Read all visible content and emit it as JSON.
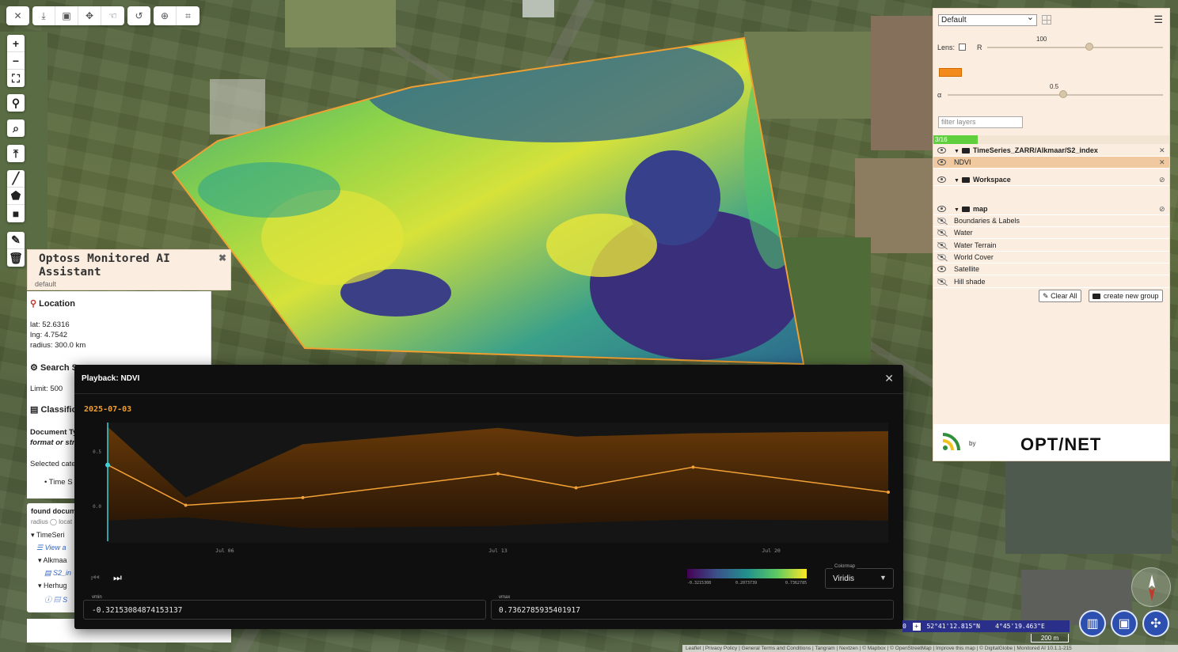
{
  "toolbar": {
    "tools": [
      "eraser-icon",
      "download-icon",
      "video-icon",
      "move-icon",
      "hand-icon",
      "history-icon",
      "circle-plus-icon",
      "fit-frame-icon"
    ]
  },
  "map_controls": [
    "zoom-in-icon",
    "zoom-out-icon",
    "fullscreen-icon",
    "location-pin-icon",
    "zoom-select-icon",
    "collapse-up-icon",
    "draw-line-icon",
    "draw-polygon-icon",
    "draw-rectangle-icon",
    "edit-icon",
    "trash-icon"
  ],
  "assistant": {
    "title": "Optoss Monitored AI Assistant",
    "subtitle": "default",
    "close": "✖",
    "location_heading": "Location",
    "lat": "lat: 52.6316",
    "lng": "lng: 4.7542",
    "radius": "radius: 300.0 km",
    "search_heading": "Search S",
    "limit_label": "Limit: ",
    "limit_value": "500",
    "classification_heading": "Classific",
    "doc_type_label": "Document Ty",
    "doc_type_hint": "format or str",
    "selected_cat": "Selected cate",
    "time_item": "Time S"
  },
  "found_panel": {
    "title": "found docume",
    "radius_row": "radius ◯ locat",
    "tree": [
      "TimeSeri",
      "View a",
      "Alkmaa",
      "S2_in",
      "Herhug",
      "S"
    ]
  },
  "layers_panel": {
    "preset": "Default",
    "lens_label": "Lens:",
    "r_label": "R",
    "r_value": "100",
    "r_fraction": 0.58,
    "alpha_label": "α",
    "alpha_value": "0.5",
    "alpha_fraction": 0.5,
    "lens_color": "#f28a1c",
    "filter_placeholder": "filter layers",
    "progress_text": "3/16",
    "rows": [
      {
        "label": "TimeSeries_ZARR/Alkmaar/S2_index",
        "bold": true,
        "folder": true,
        "visible": true,
        "selected": false
      },
      {
        "label": "NDVI",
        "bold": false,
        "folder": false,
        "visible": true,
        "selected": true
      },
      {
        "label": "Workspace",
        "bold": true,
        "folder": true,
        "visible": true,
        "selected": false
      },
      {
        "label": "map",
        "bold": true,
        "folder": true,
        "visible": true,
        "selected": false
      },
      {
        "label": "Boundaries & Labels",
        "bold": false,
        "folder": false,
        "visible": false,
        "selected": false
      },
      {
        "label": "Water",
        "bold": false,
        "folder": false,
        "visible": false,
        "selected": false
      },
      {
        "label": "Water Terrain",
        "bold": false,
        "folder": false,
        "visible": false,
        "selected": false
      },
      {
        "label": "World Cover",
        "bold": false,
        "folder": false,
        "visible": false,
        "selected": false
      },
      {
        "label": "Satellite",
        "bold": false,
        "folder": false,
        "visible": true,
        "selected": false
      },
      {
        "label": "Hill shade",
        "bold": false,
        "folder": false,
        "visible": false,
        "selected": false
      }
    ],
    "clear_all": "Clear All",
    "create_group": "create new group",
    "by_label": "by",
    "brand": "OPT/NET"
  },
  "playback": {
    "title": "Playback: NDVI",
    "close": "✕",
    "current_date": "2025-07-03",
    "colormap_label": "Colormap",
    "colormap_value": "Viridis",
    "vmin_label": "vmin",
    "vmin_value": "-0.32153084874153137",
    "vmax_label": "vmax",
    "vmax_value": "0.7362785935401917",
    "cbar_min": "-0.3215308",
    "cbar_mid": "0.2073739",
    "cbar_max": "0.7362785",
    "colors": {
      "accent": "#f0a030",
      "line": "#f4a236",
      "band": "#6a3a08",
      "cursor": "#3fd0d8",
      "viridis": [
        "#440154",
        "#3b528b",
        "#21908d",
        "#5dc963",
        "#fde725"
      ]
    }
  },
  "chart_data": {
    "type": "area",
    "title": "",
    "xlabel": "",
    "ylabel": "",
    "x_ticks": [
      "Jul 06",
      "Jul 13",
      "Jul 20"
    ],
    "y_ticks": [
      "0.5",
      "0.0"
    ],
    "ylim": [
      -0.32,
      0.74
    ],
    "x": [
      "2025-07-03",
      "2025-07-05",
      "2025-07-08",
      "2025-07-13",
      "2025-07-15",
      "2025-07-18",
      "2025-07-23"
    ],
    "series": [
      {
        "name": "",
        "role": "mean",
        "values": [
          0.38,
          0.01,
          0.08,
          0.3,
          0.17,
          0.36,
          0.13
        ]
      },
      {
        "name": "",
        "role": "max",
        "values": [
          0.73,
          0.08,
          0.57,
          0.72,
          0.64,
          0.67,
          0.69
        ]
      },
      {
        "name": "",
        "role": "min",
        "values": [
          -0.13,
          -0.1,
          -0.2,
          -0.18,
          -0.15,
          -0.12,
          -0.13
        ]
      }
    ]
  },
  "status": {
    "zoom_hint": "0",
    "coords": "52°41'12.815\"N    4°45'19.463\"E",
    "scale": "200 m",
    "attribution": "Leaflet | Privacy Policy | General Terms and Conditions | Tangram | Nextzen | © Mapbox | © OpenStreetMap | Improve this map | © DigitalGlobe | Monitored AI 10.1.1-215"
  },
  "bottom_buttons": [
    "book-icon",
    "save-icon",
    "network-icon"
  ]
}
